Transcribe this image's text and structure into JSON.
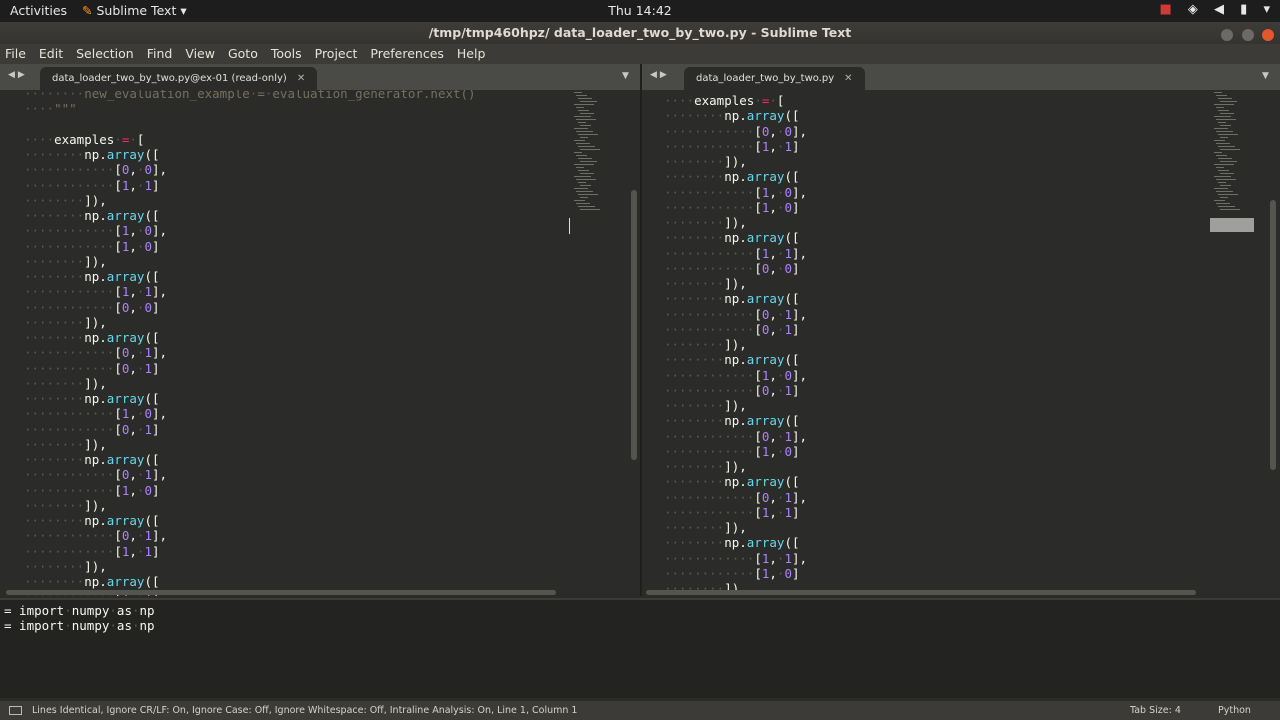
{
  "topbar": {
    "activities": "Activities",
    "app_name": "Sublime Text",
    "clock": "Thu 14:42"
  },
  "window": {
    "title": "/tmp/tmp460hpz/ data_loader_two_by_two.py - Sublime Text"
  },
  "menu": [
    "File",
    "Edit",
    "Selection",
    "Find",
    "View",
    "Goto",
    "Tools",
    "Project",
    "Preferences",
    "Help"
  ],
  "left_tab": {
    "label": "data_loader_two_by_two.py@ex-01 (read-only)"
  },
  "right_tab": {
    "label": "data_loader_two_by_two.py"
  },
  "left_code": {
    "comment_line": "new_evaluation_example = evaluation_generator.next()",
    "docstring_end": "\"\"\"",
    "assign_name": "examples",
    "arrays": [
      [
        [
          "0",
          "0"
        ],
        [
          "1",
          "1"
        ]
      ],
      [
        [
          "1",
          "0"
        ],
        [
          "1",
          "0"
        ]
      ],
      [
        [
          "1",
          "1"
        ],
        [
          "0",
          "0"
        ]
      ],
      [
        [
          "0",
          "1"
        ],
        [
          "0",
          "1"
        ]
      ],
      [
        [
          "1",
          "0"
        ],
        [
          "0",
          "1"
        ]
      ],
      [
        [
          "0",
          "1"
        ],
        [
          "1",
          "0"
        ]
      ],
      [
        [
          "0",
          "1"
        ],
        [
          "1",
          "1"
        ]
      ],
      [
        [
          "1",
          "1"
        ]
      ]
    ]
  },
  "right_code": {
    "assign_name": "examples",
    "arrays": [
      [
        [
          "0",
          "0"
        ],
        [
          "1",
          "1"
        ]
      ],
      [
        [
          "1",
          "0"
        ],
        [
          "1",
          "0"
        ]
      ],
      [
        [
          "1",
          "1"
        ],
        [
          "0",
          "0"
        ]
      ],
      [
        [
          "0",
          "1"
        ],
        [
          "0",
          "1"
        ]
      ],
      [
        [
          "1",
          "0"
        ],
        [
          "0",
          "1"
        ]
      ],
      [
        [
          "0",
          "1"
        ],
        [
          "1",
          "0"
        ]
      ],
      [
        [
          "0",
          "1"
        ],
        [
          "1",
          "1"
        ]
      ],
      [
        [
          "1",
          "1"
        ],
        [
          "1",
          "0"
        ]
      ]
    ]
  },
  "output_lines": [
    "= import numpy as np",
    "= import numpy as np"
  ],
  "status": {
    "message": "Lines Identical, Ignore CR/LF: On, Ignore Case: Off, Ignore Whitespace: Off, Intraline Analysis: On, Line 1, Column 1",
    "tab_size": "Tab Size: 4",
    "syntax": "Python"
  }
}
